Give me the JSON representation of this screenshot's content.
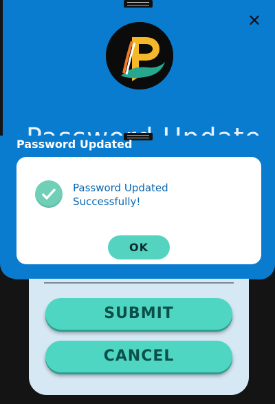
{
  "background_modal": {
    "title": "Password Update",
    "close_icon": "close-icon",
    "logo_icon": "app-logo"
  },
  "form": {
    "submit_label": "SUBMIT",
    "cancel_label": "CANCEL"
  },
  "alert": {
    "title": "Password Updated",
    "message": "Password Updated Successfully!",
    "ok_label": "OK",
    "status_icon": "check-circle-icon"
  },
  "colors": {
    "primary_blue": "#0a7cd0",
    "accent_teal": "#4fd6c2",
    "form_bg": "#d7e8f5",
    "message_text": "#0a67b0"
  }
}
